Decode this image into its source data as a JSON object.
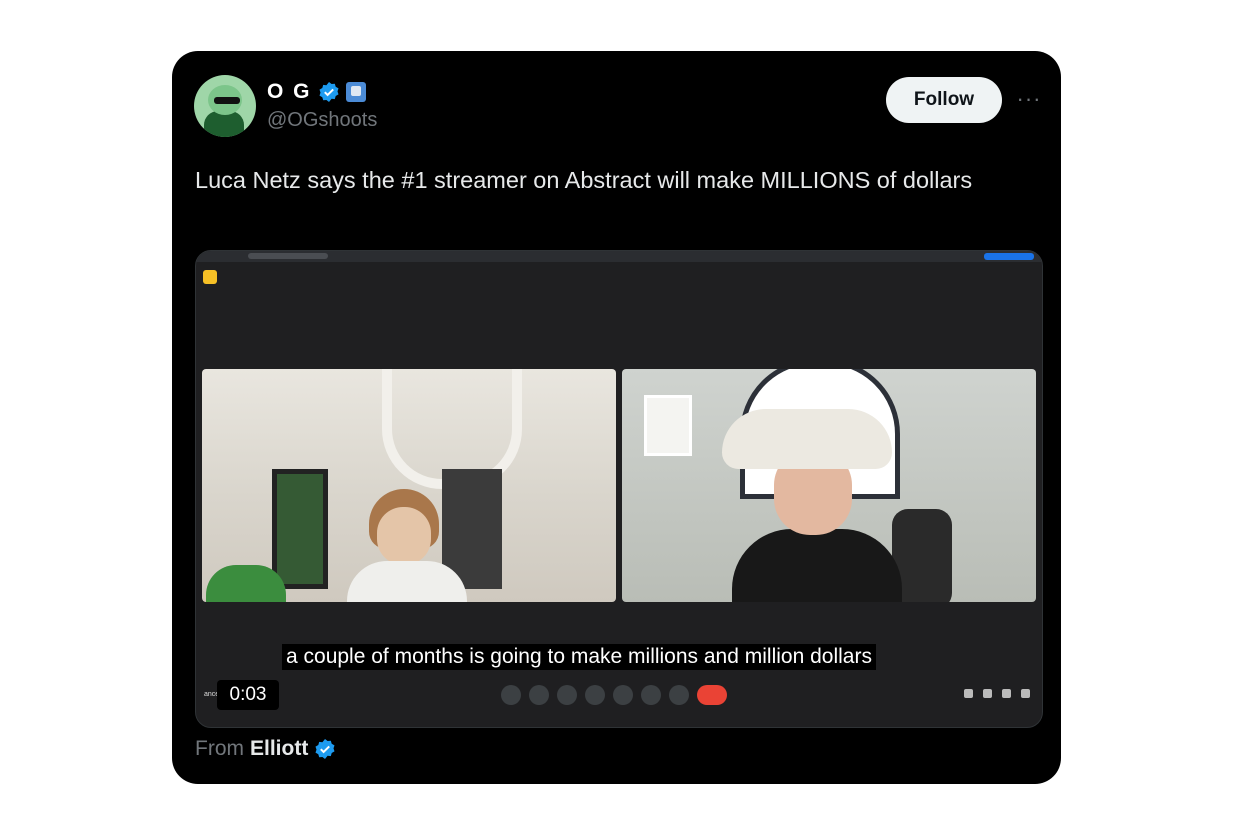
{
  "post": {
    "display_name": "O G",
    "handle": "@OGshoots",
    "follow_label": "Follow",
    "more_label": "···",
    "text": "Luca Netz says the #1 streamer on Abstract will make MILLIONS of dollars",
    "verified_color": "#1d9bf0"
  },
  "video": {
    "subtitle": "a couple of months is going to make millions and million dollars",
    "timestamp": "0:03",
    "meeting_label": "ance on Stream - O G"
  },
  "attribution": {
    "prefix": "From",
    "source_name": "Elliott"
  },
  "colors": {
    "card_bg": "#000000",
    "follow_bg": "#eff3f4",
    "text_primary": "#e7e9ea",
    "text_secondary": "#71767b",
    "end_call": "#ea4335"
  }
}
